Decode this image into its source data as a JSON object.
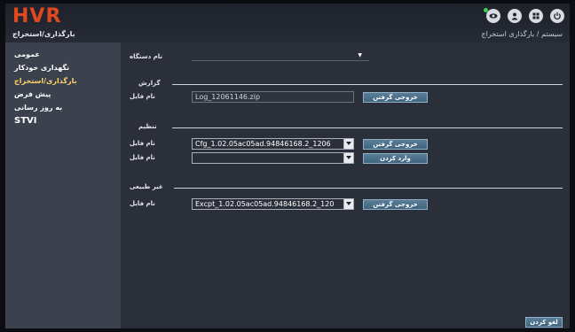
{
  "header": {
    "logo": "HVR",
    "section_title": "بارگذاری/استخراج",
    "breadcrumb": "سیستم / بارگذاری استخراج"
  },
  "top_icons": [
    "camera-icon",
    "user-icon",
    "grid-icon",
    "power-icon"
  ],
  "sidebar": {
    "items": [
      {
        "label": "عمومی"
      },
      {
        "label": "نگهداری خودکار"
      },
      {
        "label": "بارگذاری/استخراج"
      },
      {
        "label": "پیش فرض"
      },
      {
        "label": "به روز رسانی"
      },
      {
        "label": "STVI"
      }
    ]
  },
  "main": {
    "device_name_label": "نام دستگاه",
    "report": {
      "title": "گزارش",
      "file_label": "نام فایل",
      "file_value": "Log_12061146.zip",
      "export_button": "خروجی گرفتن"
    },
    "config": {
      "title": "تنظیم",
      "file_label": "نام فایل",
      "file_value": "Cfg_1.02.05ac05ad.94846168.2_1206",
      "export_button": "خروجی گرفتن",
      "import_label": "نام فایل",
      "import_value": "",
      "import_button": "وارد کردن"
    },
    "abnormal": {
      "title": "غیر طبیعی",
      "file_label": "نام فایل",
      "file_value": "Excpt_1.02.05ac05ad.94846168.2_120",
      "export_button": "خروجی گرفتن"
    },
    "cancel_button": "لغو کردن"
  }
}
